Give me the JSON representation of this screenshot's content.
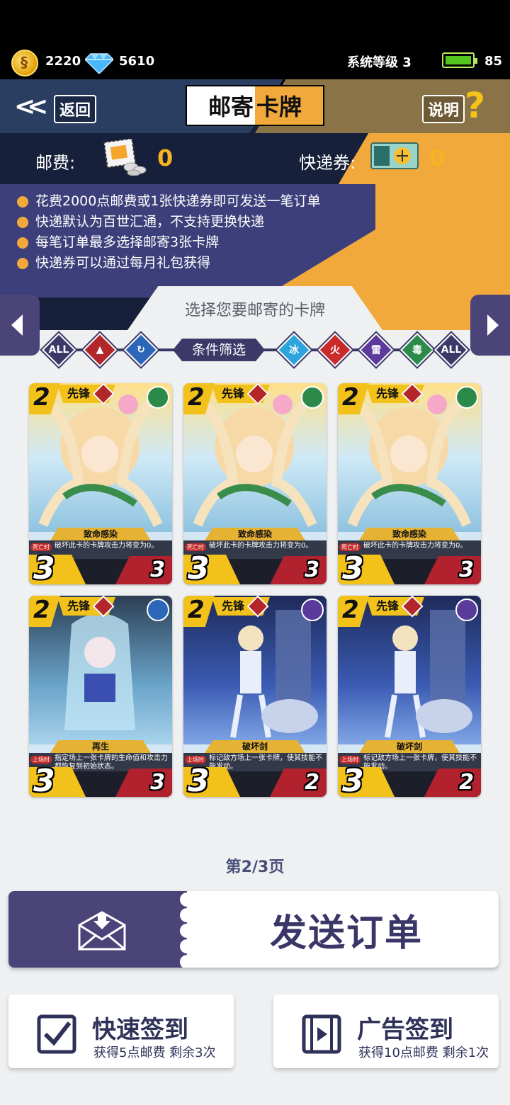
{
  "status": {
    "coins": "2220",
    "gems": "5610",
    "system_level": "系统等级 3",
    "battery": "85"
  },
  "header": {
    "back_label": "返回",
    "title_part1": "邮寄",
    "title_part2": "卡牌",
    "help_label": "说明",
    "help_symbol": "?"
  },
  "postage": {
    "label": "邮费:",
    "value": "0",
    "express_label": "快递券:",
    "express_value": "0"
  },
  "rules": [
    "花费2000点邮费或1张快递券即可发送一笔订单",
    "快递默认为百世汇通，不支持更换快递",
    "每笔订单最多选择邮寄3张卡牌",
    "快递券可以通过每月礼包获得"
  ],
  "select_title": "选择您要邮寄的卡牌",
  "filter": {
    "label": "条件筛选",
    "left": [
      {
        "name": "filter-all-class",
        "text": "ALL",
        "color": "#3c3868"
      },
      {
        "name": "filter-vanguard",
        "text": "▲",
        "color": "#b3262a"
      },
      {
        "name": "filter-support",
        "text": "↻",
        "color": "#2c66b8"
      }
    ],
    "right": [
      {
        "name": "filter-ice",
        "text": "冰",
        "color": "#2ea4dc"
      },
      {
        "name": "filter-fire",
        "text": "火",
        "color": "#c92a2a"
      },
      {
        "name": "filter-thunder",
        "text": "雷",
        "color": "#5a3a9a"
      },
      {
        "name": "filter-poison",
        "text": "毒",
        "color": "#2c8a4a"
      },
      {
        "name": "filter-all-element",
        "text": "ALL",
        "color": "#3c3868"
      }
    ]
  },
  "cards": [
    {
      "cost": "2",
      "class": "先锋",
      "skill": "致命感染",
      "tag": "死亡时",
      "desc": "破坏此卡的卡牌攻击力将变为0。",
      "atk": "3",
      "hp": "3",
      "element_color": "#2b8a4a",
      "art": "poison"
    },
    {
      "cost": "2",
      "class": "先锋",
      "skill": "致命感染",
      "tag": "死亡时",
      "desc": "破坏此卡的卡牌攻击力将变为0。",
      "atk": "3",
      "hp": "3",
      "element_color": "#2b8a4a",
      "art": "poison"
    },
    {
      "cost": "2",
      "class": "先锋",
      "skill": "致命感染",
      "tag": "死亡时",
      "desc": "破坏此卡的卡牌攻击力将变为0。",
      "atk": "3",
      "hp": "3",
      "element_color": "#2b8a4a",
      "art": "poison"
    },
    {
      "cost": "2",
      "class": "先锋",
      "skill": "再生",
      "tag": "上场时",
      "desc": "指定场上一张卡牌的生命值和攻击力都恢复到初始状态。",
      "atk": "3",
      "hp": "3",
      "element_color": "#2c66b8",
      "art": "ice"
    },
    {
      "cost": "2",
      "class": "先锋",
      "skill": "破坏剑",
      "tag": "上场时",
      "desc": "标记敌方场上一张卡牌，使其技能不能发动。",
      "atk": "3",
      "hp": "2",
      "element_color": "#5a3a9a",
      "art": "thunder"
    },
    {
      "cost": "2",
      "class": "先锋",
      "skill": "破坏剑",
      "tag": "上场时",
      "desc": "标记敌方场上一张卡牌，使其技能不能发动。",
      "atk": "3",
      "hp": "2",
      "element_color": "#5a3a9a",
      "art": "thunder"
    }
  ],
  "page_indicator": "第2/3页",
  "send_order_label": "发送订单",
  "quick_signin": {
    "title": "快速签到",
    "subtitle": "获得5点邮费  剩余3次"
  },
  "ad_signin": {
    "title": "广告签到",
    "subtitle": "获得10点邮费  剩余1次"
  }
}
